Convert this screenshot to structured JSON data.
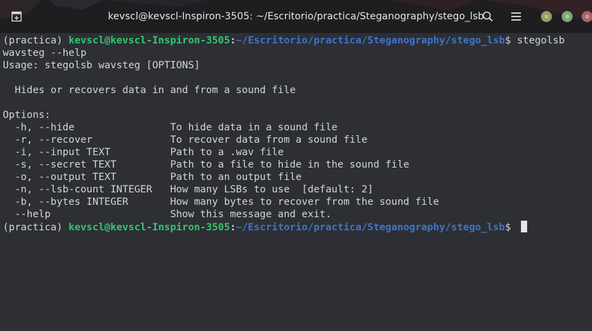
{
  "window": {
    "title": "kevscl@kevscl-Inspiron-3505: ~/Escritorio/practica/Steganography/stego_lsb",
    "icons": [
      "new-tab-icon",
      "search-icon",
      "hamburger-menu-icon",
      "minimize-icon",
      "maximize-icon",
      "close-icon"
    ],
    "colors": {
      "minimize": "#9a9a64",
      "maximize": "#7fa577",
      "close": "#a8646a",
      "user": "#36c56e",
      "path": "#3f74c7",
      "text": "#d3d7cf",
      "background": "#2d2f35"
    }
  },
  "terminal": {
    "prompt1": {
      "env": "(practica) ",
      "user": "kevscl@kevscl-Inspiron-3505",
      "sep": ":",
      "path": "~/Escritorio/practica/Steganography/stego_lsb",
      "dollar": "$ ",
      "cmd": "stegolsb"
    },
    "wrap": "wavsteg --help",
    "usage": "Usage: stegolsb wavsteg [OPTIONS]",
    "description": "  Hides or recovers data in and from a sound file",
    "options_header": "Options:",
    "options": [
      "  -h, --hide                To hide data in a sound file",
      "  -r, --recover             To recover data from a sound file",
      "  -i, --input TEXT          Path to a .wav file",
      "  -s, --secret TEXT         Path to a file to hide in the sound file",
      "  -o, --output TEXT         Path to an output file",
      "  -n, --lsb-count INTEGER   How many LSBs to use  [default: 2]",
      "  -b, --bytes INTEGER       How many bytes to recover from the sound file",
      "  --help                    Show this message and exit."
    ],
    "prompt2": {
      "env": "(practica) ",
      "user": "kevscl@kevscl-Inspiron-3505",
      "sep": ":",
      "path": "~/Escritorio/practica/Steganography/stego_lsb",
      "dollar": "$ "
    }
  }
}
